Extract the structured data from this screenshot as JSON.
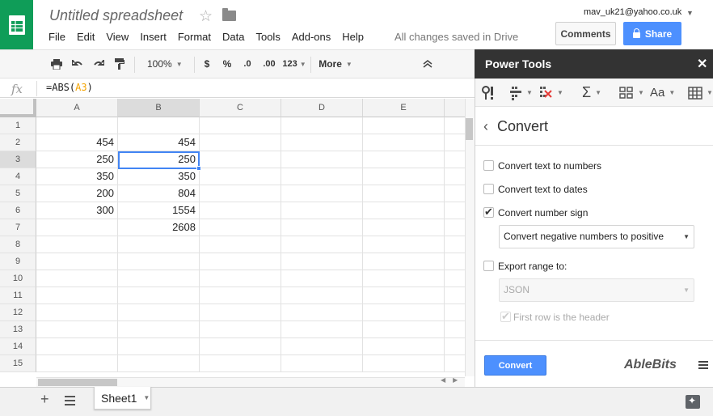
{
  "header": {
    "title": "Untitled spreadsheet",
    "menus": [
      "File",
      "Edit",
      "View",
      "Insert",
      "Format",
      "Data",
      "Tools",
      "Add-ons",
      "Help"
    ],
    "saved_status": "All changes saved in Drive",
    "account": "mav_uk21@yahoo.co.uk",
    "comments_label": "Comments",
    "share_label": "Share"
  },
  "toolbar": {
    "zoom": "100%",
    "currency": "$",
    "percent": "%",
    "dec_less": ".0",
    "dec_more": ".00",
    "format_more": "123",
    "more_label": "More"
  },
  "formula_bar": {
    "fx": "fx",
    "formula_prefix": "=ABS(",
    "formula_ref": "A3",
    "formula_suffix": ")"
  },
  "grid": {
    "columns": [
      "A",
      "B",
      "C",
      "D",
      "E"
    ],
    "rows": [
      "1",
      "2",
      "3",
      "4",
      "5",
      "6",
      "7",
      "8",
      "9",
      "10",
      "11",
      "12",
      "13",
      "14",
      "15"
    ],
    "selected_cell": "B3",
    "cells": {
      "A2": "454",
      "B2": "454",
      "A3": "250",
      "B3": "250",
      "A4": "350",
      "B4": "350",
      "A5": "200",
      "B5": "804",
      "A6": "300",
      "B6": "1554",
      "B7": "2608"
    }
  },
  "sheets": {
    "tabs": [
      "Sheet1"
    ]
  },
  "panel": {
    "title": "Power Tools",
    "section_title": "Convert",
    "options": [
      {
        "label": "Convert text to numbers",
        "checked": false
      },
      {
        "label": "Convert text to dates",
        "checked": false
      },
      {
        "label": "Convert number sign",
        "checked": true
      },
      {
        "label": "Export range to:",
        "checked": false
      }
    ],
    "sign_dropdown": "Convert negative numbers to positive",
    "export_dropdown": "JSON",
    "header_option": "First row is the header",
    "convert_button": "Convert",
    "brand": "AbleBits"
  }
}
